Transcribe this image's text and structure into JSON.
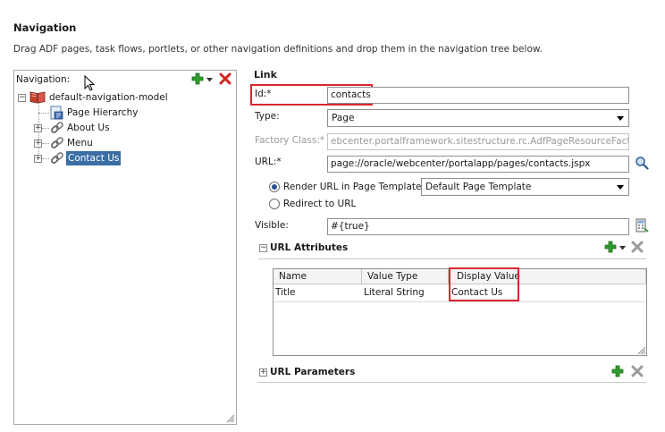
{
  "page": {
    "title": "Navigation",
    "subtitle": "Drag ADF pages, task flows, portlets, or other navigation definitions and drop them in the navigation tree below."
  },
  "navigation_panel": {
    "label": "Navigation:",
    "tree": [
      {
        "label": "default-navigation-model",
        "expander": "−"
      },
      {
        "label": "Page Hierarchy",
        "expander": ""
      },
      {
        "label": "About Us",
        "expander": "+"
      },
      {
        "label": "Menu",
        "expander": "+"
      },
      {
        "label": "Contact Us",
        "expander": "+"
      }
    ],
    "selected_item": "Contact Us"
  },
  "link_form": {
    "heading": "Link",
    "id": {
      "label": "Id:*",
      "value": "contacts"
    },
    "type": {
      "label": "Type:",
      "value": "Page"
    },
    "factory_class": {
      "label": "Factory Class:*",
      "value": "ebcenter.portalframework.sitestructure.rc.AdfPageResourceFactory"
    },
    "url": {
      "label": "URL:*",
      "value": "page://oracle/webcenter/portalapp/pages/contacts.jspx"
    },
    "render_option": {
      "label": "Render URL in Page Template:",
      "template_value": "Default Page Template",
      "selected": true
    },
    "redirect_option": {
      "label": "Redirect to URL",
      "selected": false
    },
    "visible": {
      "label": "Visible:",
      "value": "#{true}"
    }
  },
  "url_attributes": {
    "title": "URL Attributes",
    "expander": "−",
    "columns": [
      "Name",
      "Value Type",
      "Display Value"
    ],
    "rows": [
      [
        "Title",
        "Literal String",
        "Contact Us"
      ]
    ]
  },
  "url_parameters": {
    "title": "URL Parameters",
    "expander": "+"
  },
  "colors": {
    "highlight_red": "#d9272e",
    "add_green": "#2e9b2e",
    "delete_red": "#d8261e",
    "selection_blue": "#3a6ea5"
  },
  "icons": [
    "add-icon",
    "dropdown-arrow-icon",
    "delete-icon",
    "book-icon",
    "page-hierarchy-icon",
    "link-icon",
    "search-icon",
    "expression-builder-icon",
    "resize-grip-icon",
    "mouse-cursor-icon"
  ]
}
